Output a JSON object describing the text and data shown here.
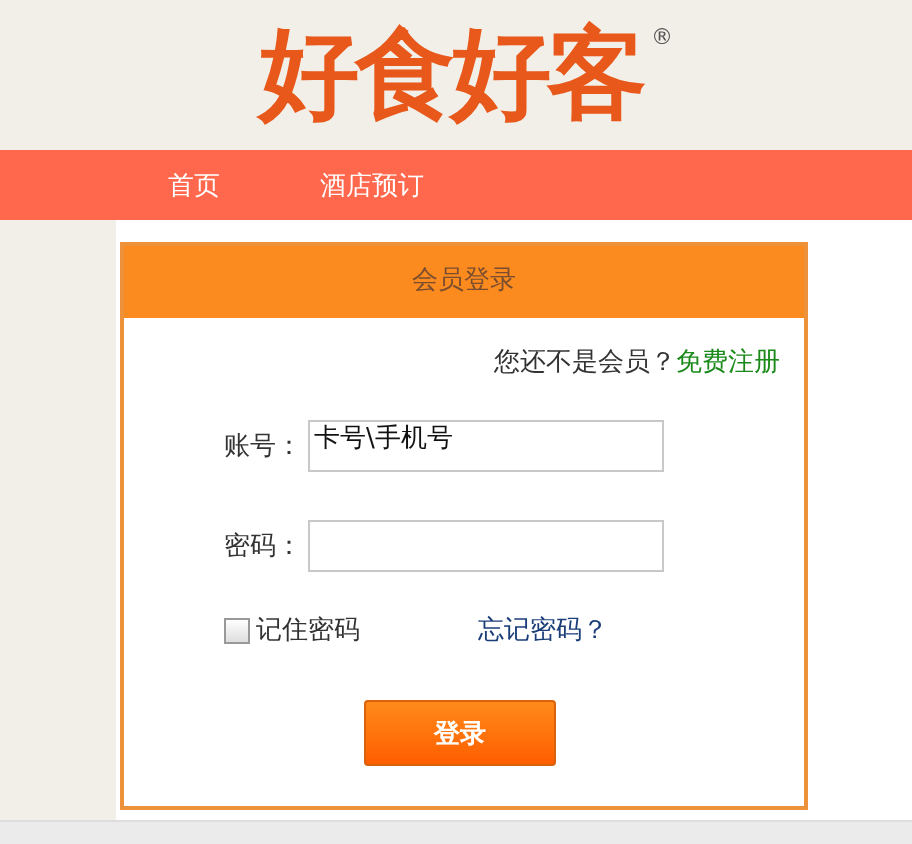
{
  "logo": {
    "text": "好食好客",
    "mark": "®"
  },
  "nav": [
    {
      "label": "首页"
    },
    {
      "label": "酒店预订"
    }
  ],
  "login": {
    "title": "会员登录",
    "prompt": "您还不是会员？",
    "register_link": "免费注册",
    "fields": [
      {
        "label": "账号：",
        "value": "卡号\\手机号"
      },
      {
        "label": "密码："
      }
    ],
    "remember": {
      "label": "记住密码",
      "checked": false
    },
    "forgot_link": "忘记密码？",
    "submit": "登录"
  }
}
